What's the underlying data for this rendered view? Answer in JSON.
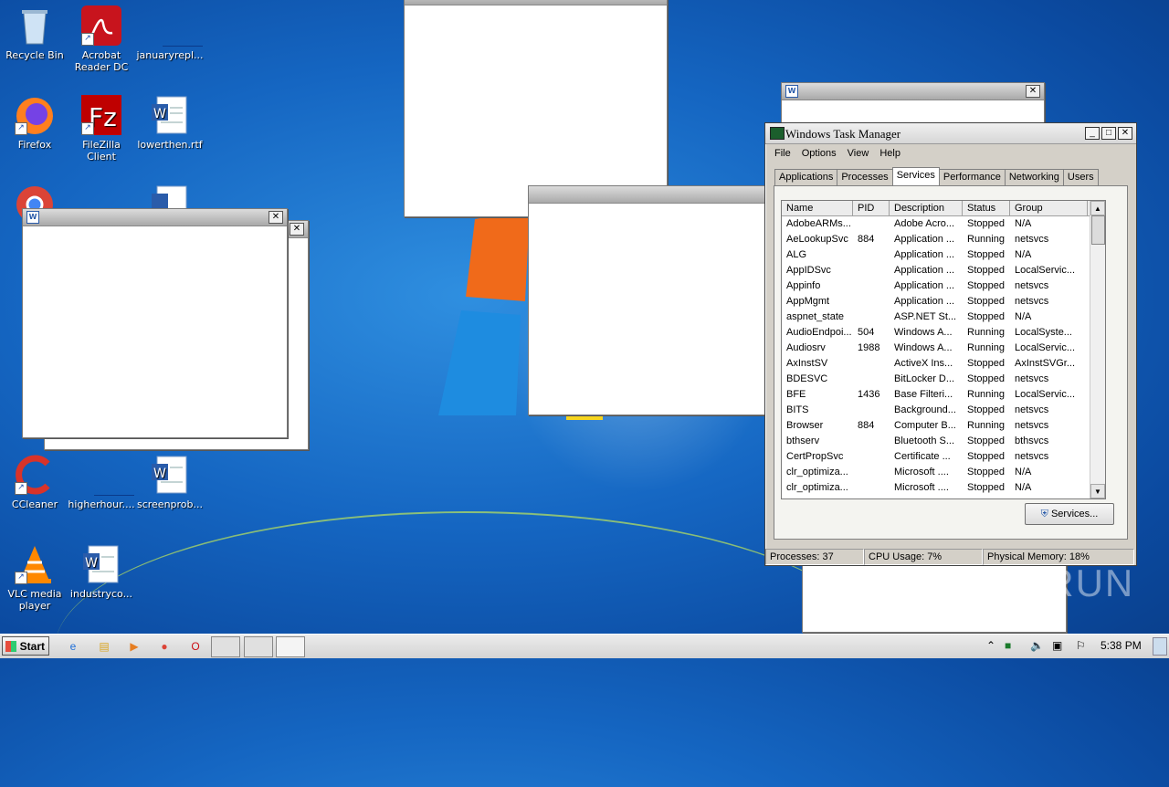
{
  "desktop": {
    "icons": [
      {
        "label": "Recycle Bin"
      },
      {
        "label": "Acrobat Reader DC"
      },
      {
        "label": "januaryrepl..."
      },
      {
        "label": "Firefox"
      },
      {
        "label": "FileZilla Client"
      },
      {
        "label": "lowerthen.rtf"
      },
      {
        "label": "CCleaner"
      },
      {
        "label": "higherhour...."
      },
      {
        "label": "screenprob..."
      },
      {
        "label": "VLC media player"
      },
      {
        "label": "industryco..."
      }
    ],
    "blank_window_close": "✕"
  },
  "task_manager": {
    "title": "Windows Task Manager",
    "controls": {
      "minimize": "_",
      "maximize": "□",
      "close": "✕"
    },
    "menu": [
      "File",
      "Options",
      "View",
      "Help"
    ],
    "tabs": [
      "Applications",
      "Processes",
      "Services",
      "Performance",
      "Networking",
      "Users"
    ],
    "active_tab": "Services",
    "columns": [
      "Name",
      "PID",
      "Description",
      "Status",
      "Group"
    ],
    "rows": [
      [
        "AdobeARMs...",
        "",
        "Adobe Acro...",
        "Stopped",
        "N/A"
      ],
      [
        "AeLookupSvc",
        "884",
        "Application ...",
        "Running",
        "netsvcs"
      ],
      [
        "ALG",
        "",
        "Application ...",
        "Stopped",
        "N/A"
      ],
      [
        "AppIDSvc",
        "",
        "Application ...",
        "Stopped",
        "LocalServic..."
      ],
      [
        "Appinfo",
        "",
        "Application ...",
        "Stopped",
        "netsvcs"
      ],
      [
        "AppMgmt",
        "",
        "Application ...",
        "Stopped",
        "netsvcs"
      ],
      [
        "aspnet_state",
        "",
        "ASP.NET St...",
        "Stopped",
        "N/A"
      ],
      [
        "AudioEndpoi...",
        "504",
        "Windows A...",
        "Running",
        "LocalSyste..."
      ],
      [
        "Audiosrv",
        "1988",
        "Windows A...",
        "Running",
        "LocalServic..."
      ],
      [
        "AxInstSV",
        "",
        "ActiveX Ins...",
        "Stopped",
        "AxInstSVGr..."
      ],
      [
        "BDESVC",
        "",
        "BitLocker D...",
        "Stopped",
        "netsvcs"
      ],
      [
        "BFE",
        "1436",
        "Base Filteri...",
        "Running",
        "LocalServic..."
      ],
      [
        "BITS",
        "",
        "Background...",
        "Stopped",
        "netsvcs"
      ],
      [
        "Browser",
        "884",
        "Computer B...",
        "Running",
        "netsvcs"
      ],
      [
        "bthserv",
        "",
        "Bluetooth S...",
        "Stopped",
        "bthsvcs"
      ],
      [
        "CertPropSvc",
        "",
        "Certificate ...",
        "Stopped",
        "netsvcs"
      ],
      [
        "clr_optimiza...",
        "",
        "Microsoft ....",
        "Stopped",
        "N/A"
      ],
      [
        "clr_optimiza...",
        "",
        "Microsoft ....",
        "Stopped",
        "N/A"
      ]
    ],
    "services_button": "Services...",
    "status": {
      "processes": "Processes: 37",
      "cpu": "CPU Usage: 7%",
      "memory": "Physical Memory: 18%"
    }
  },
  "taskbar": {
    "start_label": "Start",
    "clock": "5:38 PM"
  },
  "watermark": "ANY RUN"
}
